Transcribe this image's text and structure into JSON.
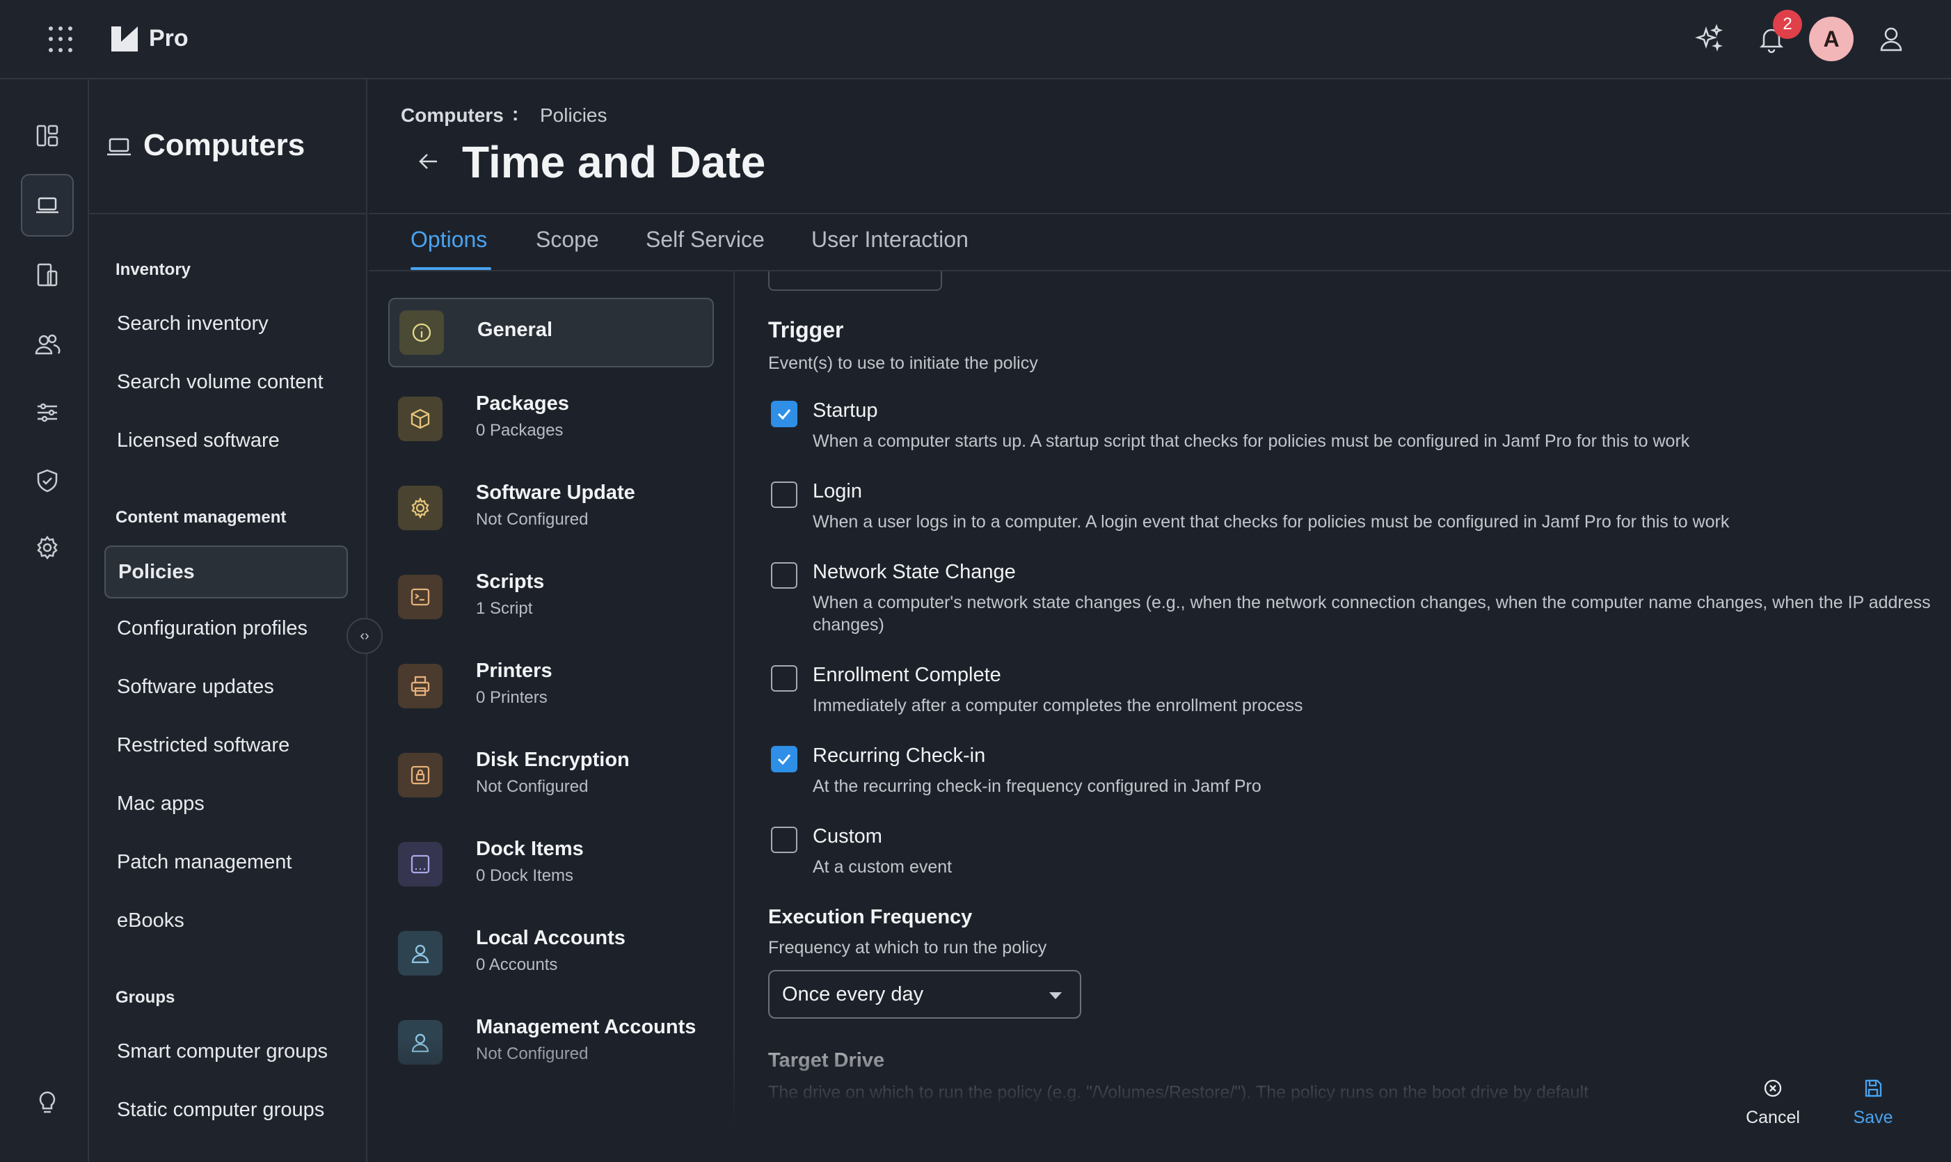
{
  "topbar": {
    "brand": "Pro",
    "notification_count": "2",
    "avatar_initial": "A"
  },
  "rail": {
    "items": [
      "dashboard-icon",
      "computers-icon",
      "devices-icon",
      "users-icon",
      "settings-sliders-icon",
      "security-shield-icon",
      "gear-icon",
      "lightbulb-icon"
    ]
  },
  "nav": {
    "title": "Computers",
    "sections": [
      {
        "label": "Inventory",
        "items": [
          "Search inventory",
          "Search volume content",
          "Licensed software"
        ]
      },
      {
        "label": "Content management",
        "items": [
          "Policies",
          "Configuration profiles",
          "Software updates",
          "Restricted software",
          "Mac apps",
          "Patch management",
          "eBooks"
        ]
      },
      {
        "label": "Groups",
        "items": [
          "Smart computer groups",
          "Static computer groups"
        ]
      }
    ],
    "active_item": "Policies"
  },
  "header": {
    "breadcrumb_root": "Computers",
    "breadcrumb_sep": ":",
    "breadcrumb_current": "Policies",
    "title": "Time and Date"
  },
  "tabs": [
    "Options",
    "Scope",
    "Self Service",
    "User Interaction"
  ],
  "active_tab": "Options",
  "sections": [
    {
      "name": "General",
      "sub": "",
      "icon": "info-icon",
      "color": "#4a4a35"
    },
    {
      "name": "Packages",
      "sub": "0 Packages",
      "icon": "package-icon",
      "color": "#4a4330"
    },
    {
      "name": "Software Update",
      "sub": "Not Configured",
      "icon": "software-update-icon",
      "color": "#4a4330"
    },
    {
      "name": "Scripts",
      "sub": "1 Script",
      "icon": "script-icon",
      "color": "#4a3b2e"
    },
    {
      "name": "Printers",
      "sub": "0 Printers",
      "icon": "printer-icon",
      "color": "#4a3b2e"
    },
    {
      "name": "Disk Encryption",
      "sub": "Not Configured",
      "icon": "disk-encryption-icon",
      "color": "#4a3b2e"
    },
    {
      "name": "Dock Items",
      "sub": "0 Dock Items",
      "icon": "dock-icon",
      "color": "#35354f"
    },
    {
      "name": "Local Accounts",
      "sub": "0 Accounts",
      "icon": "account-icon",
      "color": "#2e4350"
    },
    {
      "name": "Management Accounts",
      "sub": "Not Configured",
      "icon": "account-icon",
      "color": "#2e4350"
    }
  ],
  "trigger": {
    "heading": "Trigger",
    "description": "Event(s) to use to initiate the policy",
    "items": [
      {
        "title": "Startup",
        "desc": "When a computer starts up. A startup script that checks for policies must be configured in Jamf Pro for this to work",
        "checked": true
      },
      {
        "title": "Login",
        "desc": "When a user logs in to a computer. A login event that checks for policies must be configured in Jamf Pro for this to work",
        "checked": false
      },
      {
        "title": "Network State Change",
        "desc": "When a computer's network state changes (e.g., when the network connection changes, when the computer name changes, when the IP address changes)",
        "checked": false
      },
      {
        "title": "Enrollment Complete",
        "desc": "Immediately after a computer completes the enrollment process",
        "checked": false
      },
      {
        "title": "Recurring Check-in",
        "desc": "At the recurring check-in frequency configured in Jamf Pro",
        "checked": true
      },
      {
        "title": "Custom",
        "desc": "At a custom event",
        "checked": false
      }
    ]
  },
  "execution": {
    "heading": "Execution Frequency",
    "description": "Frequency at which to run the policy",
    "selected": "Once every day"
  },
  "target_drive": {
    "heading": "Target Drive",
    "description": "The drive on which to run the policy (e.g. \"/Volumes/Restore/\"). The policy runs on the boot drive by default"
  },
  "actions": {
    "cancel": "Cancel",
    "save": "Save"
  }
}
